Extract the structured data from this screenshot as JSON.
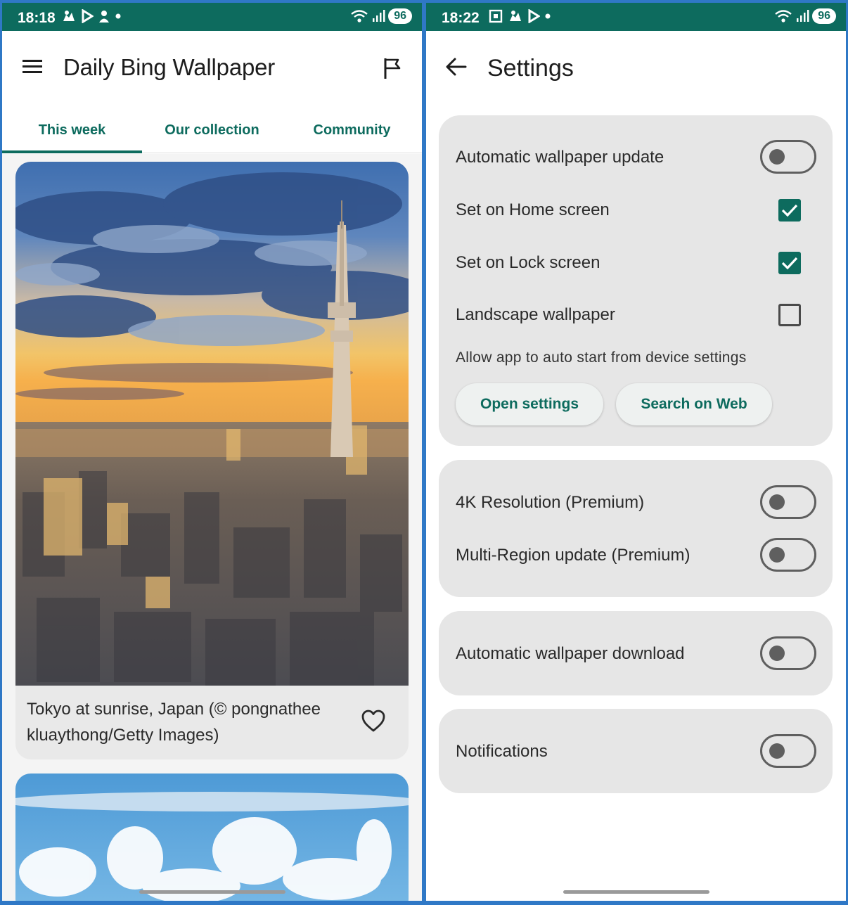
{
  "left_screen": {
    "status": {
      "time": "18:18",
      "battery": "96"
    },
    "app_title": "Daily Bing Wallpaper",
    "tabs": [
      "This week",
      "Our collection",
      "Community"
    ],
    "active_tab": "This week",
    "cards": [
      {
        "caption": "Tokyo at sunrise, Japan (© pongnathee kluaythong/Getty Images)",
        "favorited": false
      }
    ]
  },
  "right_screen": {
    "status": {
      "time": "18:22",
      "battery": "96"
    },
    "title": "Settings",
    "groups": [
      {
        "items": [
          {
            "label": "Automatic wallpaper update",
            "control": "toggle",
            "on": false
          },
          {
            "label": "Set on Home screen",
            "control": "checkbox",
            "checked": true
          },
          {
            "label": "Set on Lock screen",
            "control": "checkbox",
            "checked": true
          },
          {
            "label": "Landscape wallpaper",
            "control": "checkbox",
            "checked": false
          }
        ],
        "note": "Allow app to auto start from device settings",
        "buttons": [
          "Open settings",
          "Search on Web"
        ]
      },
      {
        "items": [
          {
            "label": "4K Resolution (Premium)",
            "control": "toggle",
            "on": false
          },
          {
            "label": "Multi-Region update (Premium)",
            "control": "toggle",
            "on": false
          }
        ]
      },
      {
        "items": [
          {
            "label": "Automatic wallpaper download",
            "control": "toggle",
            "on": false
          }
        ]
      },
      {
        "items": [
          {
            "label": "Notifications",
            "control": "toggle",
            "on": false
          }
        ]
      }
    ]
  },
  "colors": {
    "accent": "#0d6b5e",
    "status_bar": "#0d6b5e",
    "frame": "#2f78c6",
    "card_bg": "#e9e9e9",
    "group_bg": "#e6e6e6"
  },
  "icons": [
    "menu-icon",
    "flag-icon",
    "heart-icon",
    "back-arrow-icon",
    "check-icon",
    "wifi-icon",
    "signal-icon",
    "notification-icon"
  ]
}
